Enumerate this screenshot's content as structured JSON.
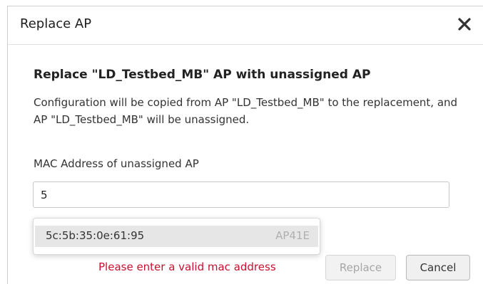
{
  "dialog": {
    "title": "Replace AP",
    "close_icon": "close-icon"
  },
  "content": {
    "heading": "Replace \"LD_Testbed_MB\" AP with unassigned AP",
    "description": "Configuration will be copied from AP \"LD_Testbed_MB\" to the replacement, and AP \"LD_Testbed_MB\" will be unassigned.",
    "field_label": "MAC Address of unassigned AP",
    "mac_input_value": "5"
  },
  "suggestions": [
    {
      "mac": "5c:5b:35:0e:61:95",
      "model": "AP41E"
    }
  ],
  "error": {
    "message": "Please enter a valid mac address",
    "color": "#c8102e"
  },
  "actions": {
    "replace_label": "Replace",
    "replace_disabled": true,
    "cancel_label": "Cancel"
  }
}
